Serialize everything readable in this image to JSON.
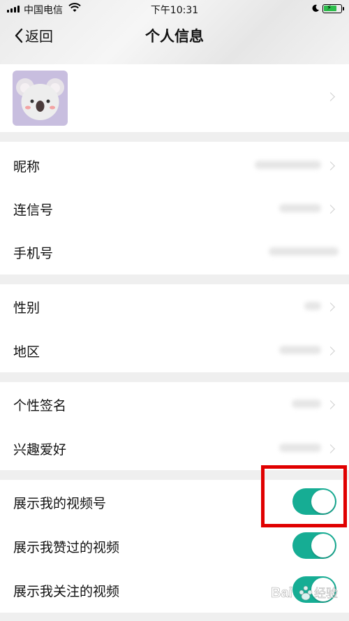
{
  "status_bar": {
    "carrier": "中国电信",
    "time": "下午10:31"
  },
  "nav": {
    "back_label": "返回",
    "title": "个人信息"
  },
  "profile": {
    "avatar": "koala-avatar"
  },
  "section_basic": [
    {
      "label": "昵称"
    },
    {
      "label": "连信号"
    },
    {
      "label": "手机号"
    }
  ],
  "section_location": [
    {
      "label": "性别"
    },
    {
      "label": "地区"
    }
  ],
  "section_personal": [
    {
      "label": "个性签名"
    },
    {
      "label": "兴趣爱好"
    }
  ],
  "section_video": [
    {
      "label": "展示我的视频号",
      "toggle": true
    },
    {
      "label": "展示我赞过的视频",
      "toggle": true
    },
    {
      "label": "展示我关注的视频",
      "toggle": true
    }
  ],
  "colors": {
    "toggle_on": "#16ad94",
    "highlight": "#e00000",
    "avatar_bg": "#c8bedf"
  },
  "watermark": {
    "text": "Bai 经验"
  }
}
